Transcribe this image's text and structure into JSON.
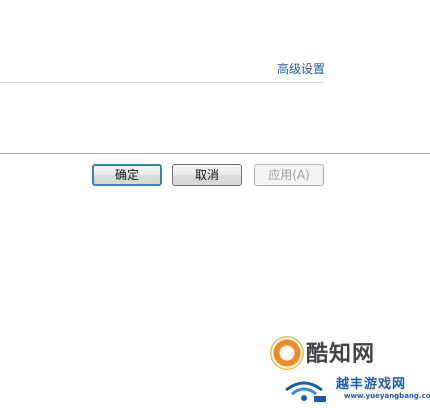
{
  "settings": {
    "advanced_link": "高级设置"
  },
  "buttons": {
    "ok": "确定",
    "cancel": "取消",
    "apply": "应用(A)"
  },
  "watermark": {
    "brand": "酷知网",
    "sub_brand": "越丰游戏网",
    "sub_url": "www.yueyangbang.com",
    "accent_orange": "#f08a22",
    "accent_blue": "#1e5aa8"
  }
}
